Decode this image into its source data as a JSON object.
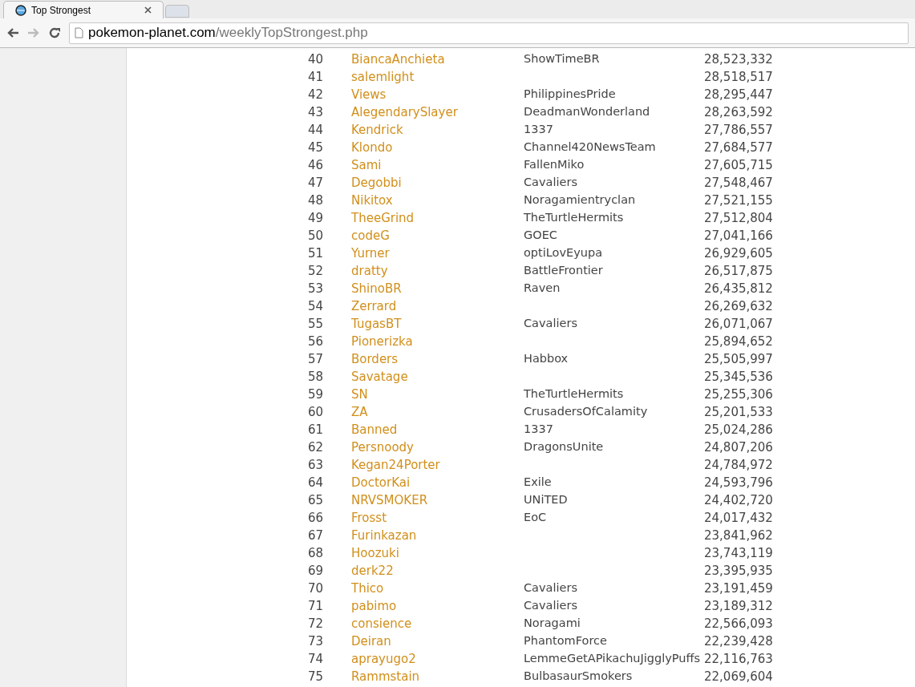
{
  "browser": {
    "tab_title": "Top Strongest",
    "url_host": "pokemon-planet.com",
    "url_path": "/weeklyTopStrongest.php"
  },
  "table": {
    "rows": [
      {
        "rank": "40",
        "name": "BiancaAnchieta",
        "clan": "ShowTimeBR",
        "score": "28,523,332"
      },
      {
        "rank": "41",
        "name": "salemlight",
        "score": "28,518,517"
      },
      {
        "rank": "42",
        "name": "Views",
        "clan": "PhilippinesPride",
        "score": "28,295,447"
      },
      {
        "rank": "43",
        "name": "AlegendarySlayer",
        "clan": "DeadmanWonderland",
        "score": "28,263,592"
      },
      {
        "rank": "44",
        "name": "Kendrick",
        "clan": "1337",
        "score": "27,786,557"
      },
      {
        "rank": "45",
        "name": "Klondo",
        "clan": "Channel420NewsTeam",
        "score": "27,684,577"
      },
      {
        "rank": "46",
        "name": "Sami",
        "clan": "FallenMiko",
        "score": "27,605,715"
      },
      {
        "rank": "47",
        "name": "Degobbi",
        "clan": "Cavaliers",
        "score": "27,548,467"
      },
      {
        "rank": "48",
        "name": "Nikitox",
        "clan": "Noragamientryclan",
        "score": "27,521,155"
      },
      {
        "rank": "49",
        "name": "TheeGrind",
        "clan": "TheTurtleHermits",
        "score": "27,512,804"
      },
      {
        "rank": "50",
        "name": "codeG",
        "clan": "GOEC",
        "score": "27,041,166"
      },
      {
        "rank": "51",
        "name": "Yurner",
        "clan": "optiLovEyupa",
        "score": "26,929,605"
      },
      {
        "rank": "52",
        "name": "dratty",
        "clan": "BattleFrontier",
        "score": "26,517,875"
      },
      {
        "rank": "53",
        "name": "ShinoBR",
        "clan": "Raven",
        "score": "26,435,812"
      },
      {
        "rank": "54",
        "name": "Zerrard",
        "score": "26,269,632"
      },
      {
        "rank": "55",
        "name": "TugasBT",
        "clan": "Cavaliers",
        "score": "26,071,067"
      },
      {
        "rank": "56",
        "name": "Pionerizka",
        "score": "25,894,652"
      },
      {
        "rank": "57",
        "name": "Borders",
        "clan": "Habbox",
        "score": "25,505,997"
      },
      {
        "rank": "58",
        "name": "Savatage",
        "score": "25,345,536"
      },
      {
        "rank": "59",
        "name": "SN",
        "clan": "TheTurtleHermits",
        "score": "25,255,306"
      },
      {
        "rank": "60",
        "name": "ZA",
        "clan": "CrusadersOfCalamity",
        "score": "25,201,533"
      },
      {
        "rank": "61",
        "name": "Banned",
        "clan": "1337",
        "score": "25,024,286"
      },
      {
        "rank": "62",
        "name": "Persnoody",
        "clan": "DragonsUnite",
        "score": "24,807,206"
      },
      {
        "rank": "63",
        "name": "Kegan24Porter",
        "score": "24,784,972"
      },
      {
        "rank": "64",
        "name": "DoctorKai",
        "clan": "Exile",
        "score": "24,593,796"
      },
      {
        "rank": "65",
        "name": "NRVSMOKER",
        "clan": "UNiTED",
        "score": "24,402,720"
      },
      {
        "rank": "66",
        "name": "Frosst",
        "clan": "EoC",
        "score": "24,017,432"
      },
      {
        "rank": "67",
        "name": "Furinkazan",
        "score": "23,841,962"
      },
      {
        "rank": "68",
        "name": "Hoozuki",
        "score": "23,743,119"
      },
      {
        "rank": "69",
        "name": "derk22",
        "score": "23,395,935"
      },
      {
        "rank": "70",
        "name": "Thico",
        "clan": "Cavaliers",
        "score": "23,191,459"
      },
      {
        "rank": "71",
        "name": "pabimo",
        "clan": "Cavaliers",
        "score": "23,189,312"
      },
      {
        "rank": "72",
        "name": "consience",
        "clan": "Noragami",
        "score": "22,566,093"
      },
      {
        "rank": "73",
        "name": "Deiran",
        "clan": "PhantomForce",
        "score": "22,239,428"
      },
      {
        "rank": "74",
        "name": "aprayugo2",
        "clan": "LemmeGetAPikachuJigglyPuffs",
        "score": "22,116,763"
      },
      {
        "rank": "75",
        "name": "Rammstain",
        "clan": "BulbasaurSmokers",
        "score": "22,069,604"
      }
    ]
  }
}
